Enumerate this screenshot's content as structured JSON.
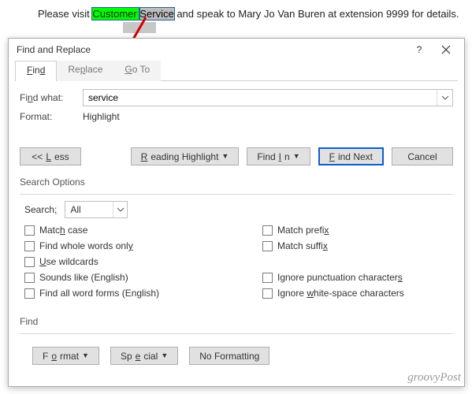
{
  "document": {
    "pre": "Please visit ",
    "highlight1": "Customer ",
    "highlight2": "Service",
    "post": " and speak to Mary Jo Van Buren at extension 9999 for details."
  },
  "dialog": {
    "title": "Find and Replace",
    "help_tip": "?",
    "tabs": {
      "find": "Find",
      "replace": "Replace",
      "goto": "Go To"
    },
    "find_what_label": "Find what:",
    "find_what_value": "service",
    "format_label": "Format:",
    "format_value": "Highlight",
    "buttons": {
      "less": "<< Less",
      "reading": "Reading Highlight",
      "findin": "Find In",
      "findnext": "Find Next",
      "cancel": "Cancel"
    },
    "search_options_title": "Search Options",
    "search_label": "Search:",
    "search_value": "All",
    "opts_left": {
      "match_case": "Match case",
      "whole_words": "Find whole words only",
      "wildcards": "Use wildcards",
      "sounds_like": "Sounds like (English)",
      "word_forms": "Find all word forms (English)"
    },
    "opts_right": {
      "prefix": "Match prefix",
      "suffix": "Match suffix",
      "ignore_punct": "Ignore punctuation characters",
      "ignore_ws": "Ignore white-space characters"
    },
    "find_section": "Find",
    "bottom_buttons": {
      "format": "Format",
      "special": "Special",
      "noformat": "No Formatting"
    }
  },
  "watermark": "groovyPost"
}
